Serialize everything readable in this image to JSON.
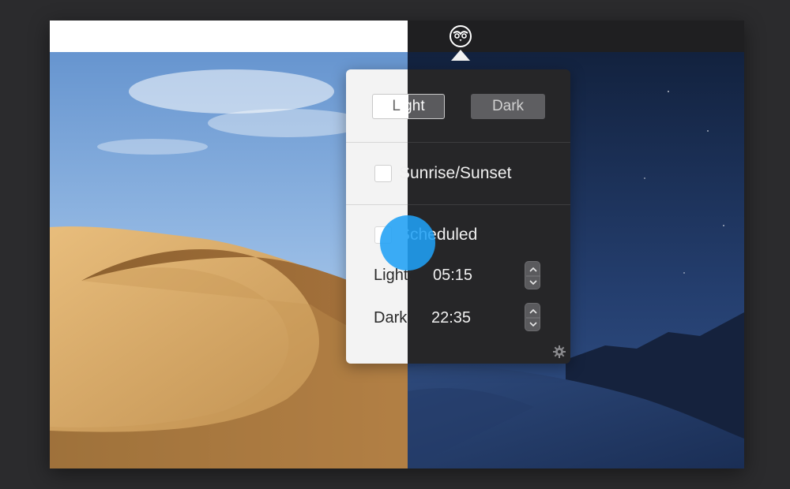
{
  "popover": {
    "mode_light_label": "Light",
    "mode_dark_label": "Dark",
    "sunrise_sunset_label": "Sunrise/Sunset",
    "scheduled_label": "Scheduled",
    "light_time_label": "Light:",
    "light_time_value": "05:15",
    "dark_time_label": "Dark:",
    "dark_time_value": "22:35"
  },
  "colors": {
    "light_panel": "#f3f3f3",
    "dark_panel": "#262628",
    "touch_indicator": "#20a0f5"
  },
  "icons": {
    "menubar": "owl-icon",
    "settings": "gear-icon",
    "stepper": "chevron-up-down-icon"
  }
}
